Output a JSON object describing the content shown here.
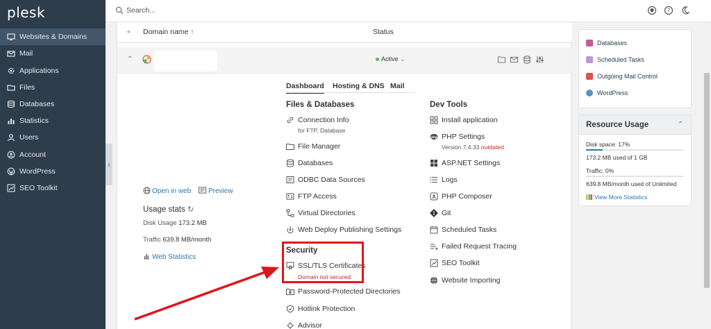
{
  "app": {
    "logo": "plesk"
  },
  "sidebar": {
    "items": [
      {
        "label": "Websites & Domains",
        "icon": "monitor-icon"
      },
      {
        "label": "Mail",
        "icon": "mail-icon"
      },
      {
        "label": "Applications",
        "icon": "gear-icon"
      },
      {
        "label": "Files",
        "icon": "folder-icon"
      },
      {
        "label": "Databases",
        "icon": "database-icon"
      },
      {
        "label": "Statistics",
        "icon": "chart-icon"
      },
      {
        "label": "Users",
        "icon": "user-icon"
      },
      {
        "label": "Account",
        "icon": "account-icon"
      },
      {
        "label": "WordPress",
        "icon": "wordpress-icon"
      },
      {
        "label": "SEO Toolkit",
        "icon": "seo-icon"
      }
    ],
    "active_item": "Websites & Domains",
    "collapse_glyph": "‹"
  },
  "search": {
    "placeholder": "Search..."
  },
  "table": {
    "col_domain": "Domain name",
    "col_status": "Status",
    "sort_glyph": "↑",
    "row_status": "Active"
  },
  "tabs": [
    "Dashboard",
    "Hosting & DNS",
    "Mail"
  ],
  "left_info": {
    "open_in_web": "Open in web",
    "preview": "Preview",
    "usage_title": "Usage stats",
    "disk_label": "Disk Usage",
    "disk_value": "173.2 MB",
    "traffic_label": "Traffic",
    "traffic_value": "639.8 MB/month",
    "web_statistics": "Web Statistics"
  },
  "files_databases": {
    "title": "Files & Databases",
    "items": [
      {
        "label": "Connection Info",
        "icon": "link-icon",
        "note": "for FTP, Database"
      },
      {
        "label": "File Manager",
        "icon": "folder-icon"
      },
      {
        "label": "Databases",
        "icon": "database-icon"
      },
      {
        "label": "ODBC Data Sources",
        "icon": "odbc-icon"
      },
      {
        "label": "FTP Access",
        "icon": "ftp-icon"
      },
      {
        "label": "Virtual Directories",
        "icon": "virtual-dir-icon"
      },
      {
        "label": "Web Deploy Publishing Settings",
        "icon": "deploy-icon"
      }
    ]
  },
  "security": {
    "title": "Security",
    "items": [
      {
        "label": "SSL/TLS Certificates",
        "icon": "certificate-icon",
        "note": "Domain not secured"
      },
      {
        "label": "Password-Protected Directories",
        "icon": "lock-folder-icon"
      },
      {
        "label": "Hotlink Protection",
        "icon": "hotlink-icon"
      },
      {
        "label": "Advisor",
        "icon": "advisor-icon"
      }
    ]
  },
  "dev_tools": {
    "title": "Dev Tools",
    "items": [
      {
        "label": "Install application",
        "icon": "grid-icon"
      },
      {
        "label": "PHP Settings",
        "icon": "php-icon",
        "note_prefix": "Version 7.4.33",
        "note_status": "outdated"
      },
      {
        "label": "ASP.NET Settings",
        "icon": "aspnet-icon"
      },
      {
        "label": "Logs",
        "icon": "logs-icon"
      },
      {
        "label": "PHP Composer",
        "icon": "composer-icon"
      },
      {
        "label": "Git",
        "icon": "git-icon"
      },
      {
        "label": "Scheduled Tasks",
        "icon": "calendar-icon"
      },
      {
        "label": "Failed Request Tracing",
        "icon": "trace-icon"
      },
      {
        "label": "SEO Toolkit",
        "icon": "seo-icon"
      },
      {
        "label": "Website Importing",
        "icon": "globe-icon"
      }
    ]
  },
  "right_links": [
    {
      "label": "Databases",
      "color": "#c45b9b"
    },
    {
      "label": "Scheduled Tasks",
      "color": "#b99ad2"
    },
    {
      "label": "Outgoing Mail Control",
      "color": "#d9534f"
    },
    {
      "label": "WordPress",
      "color": "#5b8fc7"
    }
  ],
  "resource_usage": {
    "title": "Resource Usage",
    "disk_label": "Disk space: 17%",
    "disk_fraction": 0.17,
    "disk_detail": "173.2 MB used of 1 GB",
    "traffic_label": "Traffic: 0%",
    "traffic_fraction": 0.0,
    "traffic_detail": "639.8 MB/month used of Unlimited",
    "more_link": "View More Statistics"
  },
  "colors": {
    "sidebar": "#2e3d4c",
    "link": "#2878b0",
    "active_status": "#5cb85c",
    "highlight": "#e0141c"
  }
}
